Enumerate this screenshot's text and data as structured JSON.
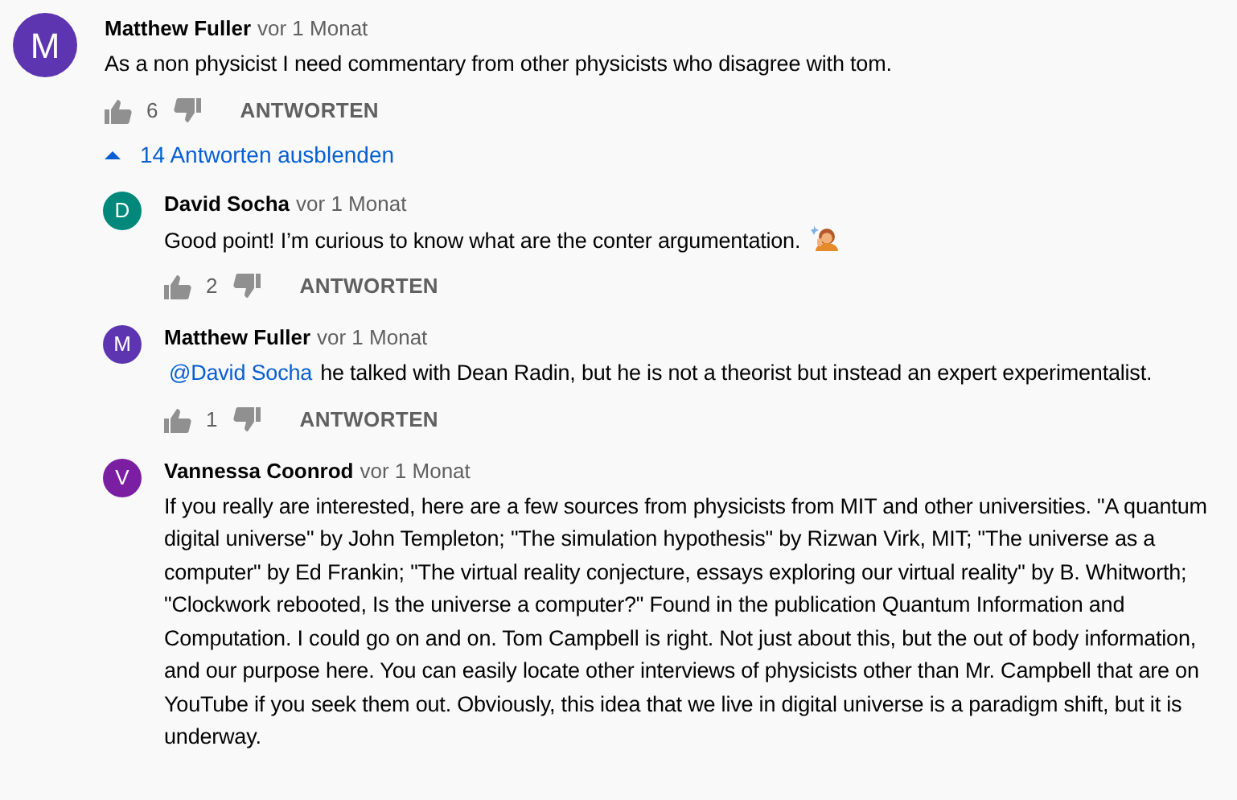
{
  "comment": {
    "author": "Matthew Fuller",
    "time": "vor 1 Monat",
    "avatar": "M",
    "color": "#5e35b1",
    "text": "As a non physicist I need commentary from other physicists who disagree with tom.",
    "likes": "6",
    "reply_button": "ANTWORTEN"
  },
  "replies_toggle": {
    "label": "14 Antworten ausblenden",
    "expanded": true
  },
  "replies": [
    {
      "author": "David Socha",
      "time": "vor 1 Monat",
      "avatar": "D",
      "color": "#00897b",
      "text": "Good point!  I’m curious to know what are the conter argumentation.",
      "emoji": true,
      "likes": "2",
      "reply_button": "ANTWORTEN"
    },
    {
      "author": "Matthew Fuller",
      "time": "vor 1 Monat",
      "avatar": "M",
      "color": "#5e35b1",
      "mention": "@David Socha",
      "text": "he talked with Dean Radin, but he is not a theorist but instead an expert experimentalist.",
      "likes": "1",
      "reply_button": "ANTWORTEN"
    },
    {
      "author": "Vannessa Coonrod",
      "time": "vor 1 Monat",
      "avatar": "V",
      "color": "#7b1fa2",
      "text": "If you really are interested, here are a few sources from physicists from MIT and other universities. \"A quantum digital universe\" by John Templeton; \"The simulation hypothesis\" by Rizwan Virk, MIT; \"The universe as a computer\" by Ed Frankin; \"The virtual reality conjecture, essays exploring our virtual reality\" by B. Whitworth; \"Clockwork rebooted, Is the universe a computer?\" Found in the publication Quantum Information and Computation. I could go on and on. Tom Campbell is right. Not just about this, but the out of body information, and our purpose here. You can easily locate other interviews of physicists other than Mr. Campbell that are on YouTube if you seek them out. Obviously, this idea that we live in  digital universe is a paradigm shift, but it is underway."
    }
  ]
}
